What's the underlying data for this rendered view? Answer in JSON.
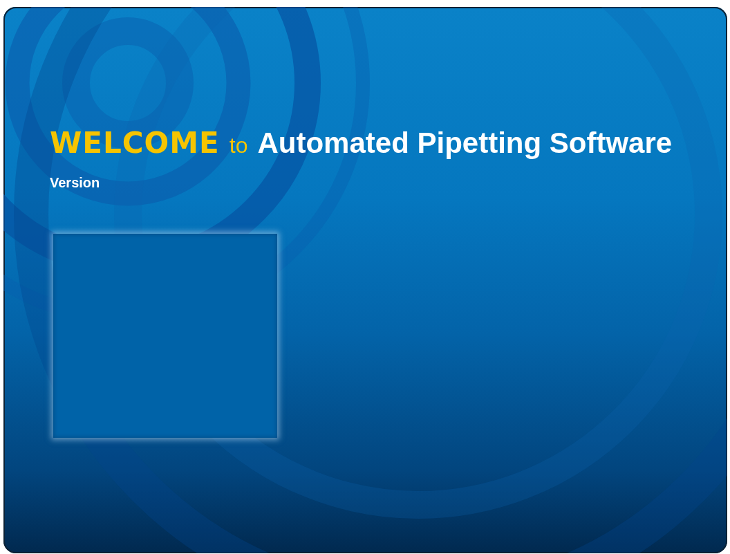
{
  "splash": {
    "welcome_word": "WELCOME",
    "joiner": "to",
    "product_name": "Automated Pipetting Software",
    "version_label": "Version"
  }
}
